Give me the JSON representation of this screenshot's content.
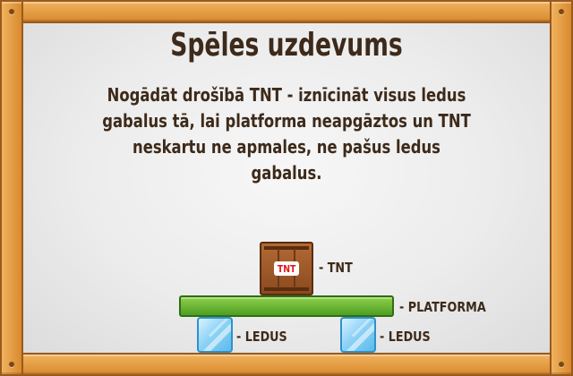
{
  "title": "Spēles uzdevums",
  "description": {
    "line1": "Nogādāt drošībā TNT - iznīcināt visus ledus",
    "line2": "gabalus tā, lai platforma neapgāztos un TNT",
    "line3": "neskartu ne apmales, ne pašus ledus gabalus."
  },
  "legend": {
    "tnt_box_text": "TNT",
    "tnt_label": "- TNT",
    "platform_label": "- PLATFORMA",
    "ice_label_left": "- LEDUS",
    "ice_label_right": "- LEDUS"
  },
  "colors": {
    "frame_wood": "#d9892e",
    "text_brown": "#3d2a1a",
    "platform_green": "#5aaa2a",
    "ice_blue": "#8fd3f7",
    "tnt_red": "#e01515"
  }
}
